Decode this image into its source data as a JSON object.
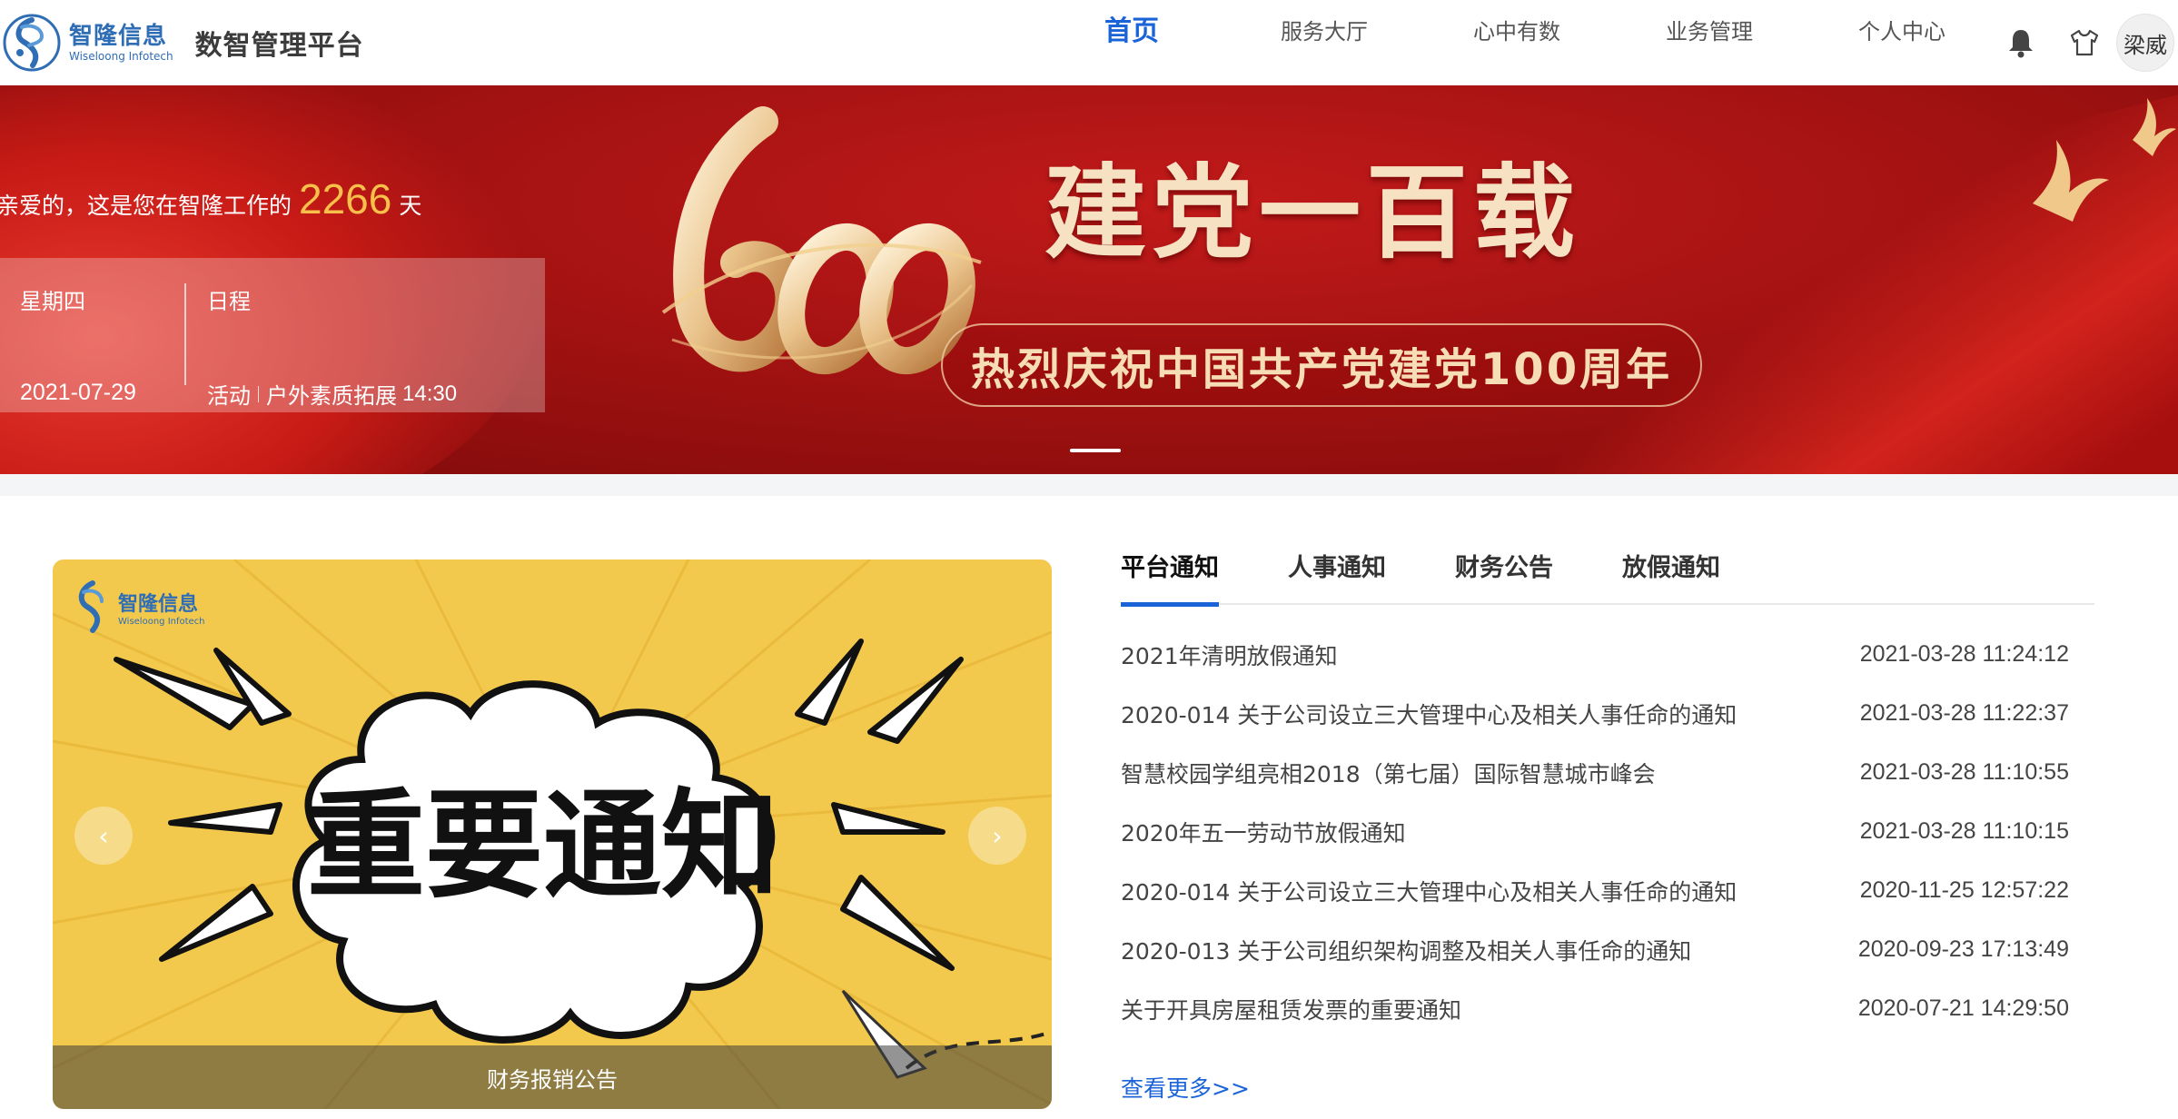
{
  "header": {
    "brand_cn": "智隆信息",
    "brand_en": "Wiseloong Infotech",
    "platform_title": "数智管理平台",
    "nav": [
      {
        "label": "首页",
        "active": true
      },
      {
        "label": "服务大厅",
        "active": false
      },
      {
        "label": "心中有数",
        "active": false
      },
      {
        "label": "业务管理",
        "active": false
      },
      {
        "label": "个人中心",
        "active": false
      }
    ],
    "icons": [
      "bell-icon",
      "tshirt-icon"
    ],
    "user_name": "梁威"
  },
  "banner": {
    "welcome_prefix": "亲爱的，这是您在智隆工作的",
    "days": "2266",
    "days_unit": "天",
    "weekday": "星期四",
    "date": "2021-07-29",
    "schedule_label": "日程",
    "event_type": "活动",
    "event_name": "户外素质拓展",
    "event_time": "14:30",
    "title": "建党一百载",
    "subtitle": "热烈庆祝中国共产党建党100周年",
    "colors": {
      "primary": "#b81616",
      "gold": "#f6dcb7",
      "days": "#f7c04a"
    }
  },
  "carousel": {
    "logo_cn": "智隆信息",
    "logo_en": "Wiseloong Infotech",
    "art_text": "重要通知",
    "caption": "财务报销公告",
    "prev_icon": "‹",
    "next_icon": "›"
  },
  "notices": {
    "tabs": [
      {
        "label": "平台通知",
        "active": true
      },
      {
        "label": "人事通知",
        "active": false
      },
      {
        "label": "财务公告",
        "active": false
      },
      {
        "label": "放假通知",
        "active": false
      }
    ],
    "items": [
      {
        "title": "2021年清明放假通知",
        "time": "2021-03-28 11:24:12"
      },
      {
        "title": "2020-014 关于公司设立三大管理中心及相关人事任命的通知",
        "time": "2021-03-28 11:22:37"
      },
      {
        "title": "智慧校园学组亮相2018（第七届）国际智慧城市峰会",
        "time": "2021-03-28 11:10:55"
      },
      {
        "title": "2020年五一劳动节放假通知",
        "time": "2021-03-28 11:10:15"
      },
      {
        "title": "2020-014 关于公司设立三大管理中心及相关人事任命的通知",
        "time": "2020-11-25 12:57:22"
      },
      {
        "title": "2020-013 关于公司组织架构调整及相关人事任命的通知",
        "time": "2020-09-23 17:13:49"
      },
      {
        "title": "关于开具房屋租赁发票的重要通知",
        "time": "2020-07-21 14:29:50"
      }
    ],
    "more_label": "查看更多>>",
    "accent": "#1b64d8"
  }
}
